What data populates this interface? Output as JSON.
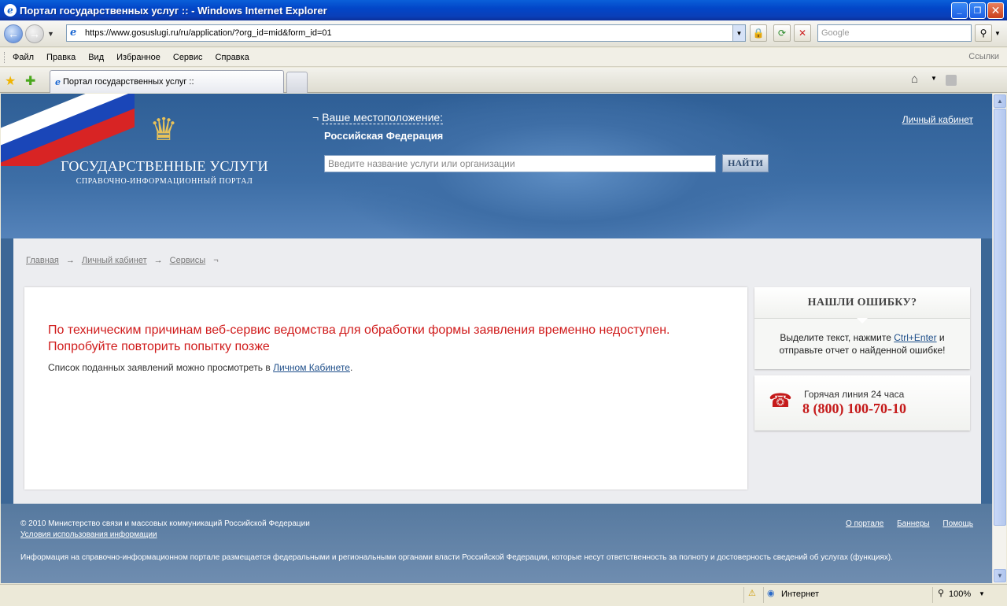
{
  "window": {
    "title": "Портал государственных услуг :: - Windows Internet Explorer",
    "minimize": "_",
    "maximize": "❐",
    "close": "✕"
  },
  "address": {
    "url": "https://www.gosuslugi.ru/ru/application/?org_id=mid&form_id=01",
    "search_placeholder": "Google"
  },
  "menu": {
    "items": [
      "Файл",
      "Правка",
      "Вид",
      "Избранное",
      "Сервис",
      "Справка"
    ],
    "links_label": "Ссылки"
  },
  "tab": {
    "label": "Портал государственных услуг ::"
  },
  "header": {
    "brand_title": "ГОСУДАРСТВЕННЫЕ УСЛУГИ",
    "brand_subtitle": "СПРАВОЧНО-ИНФОРМАЦИОННЫЙ ПОРТАЛ",
    "location_label": "Ваше местоположение:",
    "location_value": "Российская Федерация",
    "search_placeholder": "Введите название услуги или организации",
    "search_button": "НАЙТИ",
    "cabinet_link": "Личный кабинет"
  },
  "breadcrumb": {
    "items": [
      "Главная",
      "Личный кабинет",
      "Сервисы"
    ],
    "separator": "→"
  },
  "error": {
    "title": "По техническим причинам веб-сервис ведомства для обработки формы заявления временно недоступен. Попробуйте повторить попытку позже",
    "text_before": "Список поданных заявлений можно просмотреть в ",
    "link": "Личном Кабинете",
    "text_after": "."
  },
  "sidebar": {
    "found_error_title": "НАШЛИ ОШИБКУ?",
    "found_error_text_1": "Выделите текст, нажмите ",
    "found_error_shortcut": "Ctrl+Enter",
    "found_error_text_2": " и отправьте отчет о найденной ошибке!",
    "hotline_label": "Горячая линия 24 часа",
    "hotline_number": "8 (800) 100-70-10"
  },
  "footer": {
    "copyright": "© 2010 Министерство связи и массовых коммуникаций Российской Федерации",
    "terms": "Условия использования информации",
    "links": [
      "О портале",
      "Баннеры",
      "Помощь"
    ],
    "disclaimer": "Информация на справочно-информационном портале размещается федеральными и региональными органами власти Российской Федерации, которые несут ответственность за полноту и достоверность сведений об услугах (функциях)."
  },
  "statusbar": {
    "zone": "Интернет",
    "zoom": "100%"
  },
  "colors": {
    "error_red": "#d01b1b",
    "header_blue": "#3d6ea6",
    "hotline_red": "#c51a1a"
  }
}
